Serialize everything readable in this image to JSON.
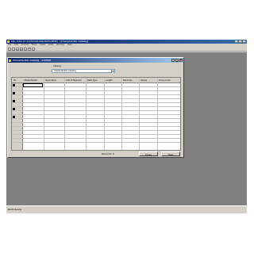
{
  "app": {
    "title": "SQL Data [C:\\DATA\\SQL\\SQLDATA.MDB] - [Characteristic Catalog]",
    "menu": [
      "File",
      "Edit",
      "Format",
      "Tools",
      "Insert",
      "Data",
      "Window",
      "Help"
    ],
    "toolbar": [
      "new-icon",
      "open-icon",
      "save-icon",
      "print-icon",
      "cut-icon",
      "copy-icon",
      "help-icon"
    ],
    "status": "NUM   Ready"
  },
  "dialog": {
    "title": "Characteristic Catalog - SAMPLE",
    "field_label": "Catalog:",
    "field_value": "Characteristic Catalog",
    "columns": [
      "No",
      "Characteristic",
      "Description",
      "Unit of Measure",
      "Data Type",
      "Length",
      "Decimals",
      "Values",
      "Group Code"
    ],
    "rows": [
      "1",
      "2",
      "3",
      "4",
      "5",
      "6",
      "7",
      "8",
      "9",
      "10",
      "11",
      "12",
      "13",
      "14",
      "15"
    ],
    "footer_text": "Records: 0",
    "buttons": {
      "close": "Close",
      "help": "Help"
    }
  }
}
